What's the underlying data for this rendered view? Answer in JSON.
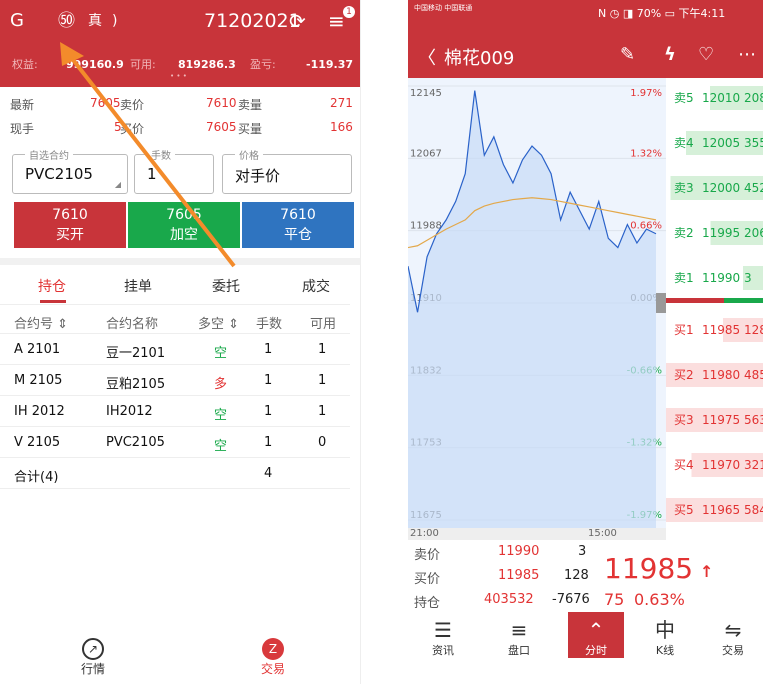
{
  "left": {
    "header": {
      "logo_icon": "G",
      "counter": "71202021",
      "icons": [
        "G",
        "㊿",
        "真",
        "☾"
      ],
      "refresh_icon": "⟳",
      "menu_icon": "≡",
      "menu_badge": "1",
      "equity_label": "权益:",
      "equity_value": "999160.9",
      "avail_label": "可用:",
      "avail_value": "819286.3",
      "pnl_label": "盈亏:",
      "pnl_value": "-119.37",
      "dots": "• • •"
    },
    "quote": {
      "last_label": "最新",
      "last_value": "7605",
      "sell_label": "卖价",
      "sell_value": "7610",
      "sellvol_label": "卖量",
      "sellvol_value": "271",
      "hand_label": "现手",
      "hand_value": "5",
      "buy_label": "买价",
      "buy_value": "7605",
      "buyvol_label": "买量",
      "buyvol_value": "166"
    },
    "order": {
      "contract_legend": "自选合约",
      "contract_value": "PVC2105",
      "qty_legend": "手数",
      "qty_value": "1",
      "price_legend": "价格",
      "price_value": "对手价"
    },
    "buttons": [
      {
        "price": "7610",
        "label": "买开",
        "color": "#c8343a"
      },
      {
        "price": "7605",
        "label": "加空",
        "color": "#19a84b"
      },
      {
        "price": "7610",
        "label": "平仓",
        "color": "#2f74c0"
      }
    ],
    "tabs": [
      "持仓",
      "挂单",
      "委托",
      "成交"
    ],
    "columns": [
      "合约号 ⇕",
      "合约名称",
      "多空 ⇕",
      "手数",
      "可用"
    ],
    "rows": [
      {
        "code": "A 2101",
        "name": "豆一2101",
        "side": "空",
        "qty": "1",
        "avail": "1"
      },
      {
        "code": "M 2105",
        "name": "豆粕2105",
        "side": "多",
        "qty": "1",
        "avail": "1"
      },
      {
        "code": "IH 2012",
        "name": "IH2012",
        "side": "空",
        "qty": "1",
        "avail": "1"
      },
      {
        "code": "V 2105",
        "name": "PVC2105",
        "side": "空",
        "qty": "1",
        "avail": "0"
      }
    ],
    "total_label": "合计(4)",
    "total_qty": "4",
    "nav": [
      {
        "icon": "↗",
        "label": "行情"
      },
      {
        "icon": "Z",
        "label": "交易"
      }
    ]
  },
  "right": {
    "status": {
      "carrier": "中国移动 中国联通",
      "right": "N ◷ ◨ 70% ▭ 下午4:11"
    },
    "title": "棉花009",
    "back_icon": "〈",
    "edit_icon": "✎",
    "flash_icon": "ϟ",
    "heart_icon": "♡",
    "more_icon": "⋯",
    "price_labels": [
      "12145",
      "12067",
      "11988",
      "11910",
      "11832",
      "11753",
      "11675"
    ],
    "pct_labels": [
      "1.97%",
      "1.32%",
      "0.66%",
      "0.00%",
      "-0.66%",
      "-1.32%",
      "-1.97%"
    ],
    "time_labels": [
      "21:00",
      "15:00"
    ],
    "asks": [
      {
        "label": "卖5",
        "price": "12010",
        "vol": "208"
      },
      {
        "label": "卖4",
        "price": "12005",
        "vol": "355"
      },
      {
        "label": "卖3",
        "price": "12000",
        "vol": "452"
      },
      {
        "label": "卖2",
        "price": "11995",
        "vol": "206"
      },
      {
        "label": "卖1",
        "price": "11990",
        "vol": "3"
      }
    ],
    "bids": [
      {
        "label": "买1",
        "price": "11985",
        "vol": "128"
      },
      {
        "label": "买2",
        "price": "11980",
        "vol": "485"
      },
      {
        "label": "买3",
        "price": "11975",
        "vol": "563"
      },
      {
        "label": "买4",
        "price": "11970",
        "vol": "321"
      },
      {
        "label": "买5",
        "price": "11965",
        "vol": "584"
      }
    ],
    "summary": {
      "sell_label": "卖价",
      "sell_price": "11990",
      "sell_vol": "3",
      "buy_label": "买价",
      "buy_price": "11985",
      "buy_vol": "128",
      "oi_label": "持仓",
      "oi_value": "403532",
      "oi_change": "-7676",
      "last": "11985",
      "arrow": "↑",
      "change": "75",
      "change_pct": "0.63%"
    },
    "nav": [
      {
        "icon": "☰",
        "label": "资讯"
      },
      {
        "icon": "≡",
        "label": "盘口"
      },
      {
        "icon": "⌃",
        "label": "分时"
      },
      {
        "icon": "中",
        "label": "K线"
      },
      {
        "icon": "⇋",
        "label": "交易"
      }
    ]
  },
  "chart_data": {
    "type": "line",
    "x_start": "21:00",
    "x_end": "15:00",
    "ylim": [
      11675,
      12145
    ],
    "reference": 11910,
    "price": [
      11950,
      11900,
      11960,
      11985,
      12000,
      12020,
      12050,
      12140,
      12070,
      12090,
      12060,
      12040,
      12065,
      12080,
      12070,
      12050,
      12000,
      12030,
      12010,
      11990,
      12020,
      11980,
      11970,
      11995,
      11975,
      11990,
      11985
    ],
    "avg": [
      11970,
      11972,
      11978,
      11984,
      11990,
      11995,
      12000,
      12010,
      12015,
      12018,
      12020,
      12022,
      12023,
      12024,
      12023,
      12022,
      12020,
      12018,
      12016,
      12014,
      12012,
      12010,
      12008,
      12006,
      12004,
      12002,
      12000
    ]
  }
}
